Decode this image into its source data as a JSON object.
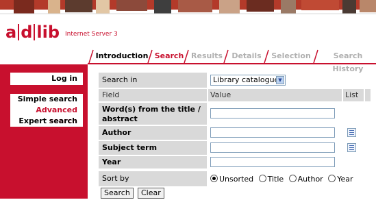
{
  "branding": {
    "logo_letters": [
      "a",
      "d",
      "lib"
    ],
    "subtitle": "Internet Server 3",
    "accent": "#c8102e"
  },
  "tabs": [
    {
      "label": "Introduction",
      "state": "normal"
    },
    {
      "label": "Search",
      "state": "active"
    },
    {
      "label": "Results",
      "state": "disabled"
    },
    {
      "label": "Details",
      "state": "disabled"
    },
    {
      "label": "Selection",
      "state": "disabled"
    },
    {
      "label": "Search History",
      "state": "disabled"
    }
  ],
  "sidebar": {
    "login": "Log in",
    "items": [
      {
        "label": "Simple search",
        "current": false
      },
      {
        "label": "Advanced search",
        "current": true
      },
      {
        "label": "Expert search",
        "current": false
      }
    ]
  },
  "form": {
    "search_in_label": "Search in",
    "search_in_value": "Library catalogue",
    "header": {
      "field": "Field",
      "value": "Value",
      "list": "List"
    },
    "fields": [
      {
        "label": "Word(s) from the title / abstract",
        "value": "",
        "has_list": false
      },
      {
        "label": "Author",
        "value": "",
        "has_list": true
      },
      {
        "label": "Subject term",
        "value": "",
        "has_list": true
      },
      {
        "label": "Year",
        "value": "",
        "has_list": false
      }
    ],
    "sort_label": "Sort by",
    "sort_options": [
      "Unsorted",
      "Title",
      "Author",
      "Year"
    ],
    "sort_selected": "Unsorted",
    "search_button": "Search",
    "clear_button": "Clear"
  }
}
